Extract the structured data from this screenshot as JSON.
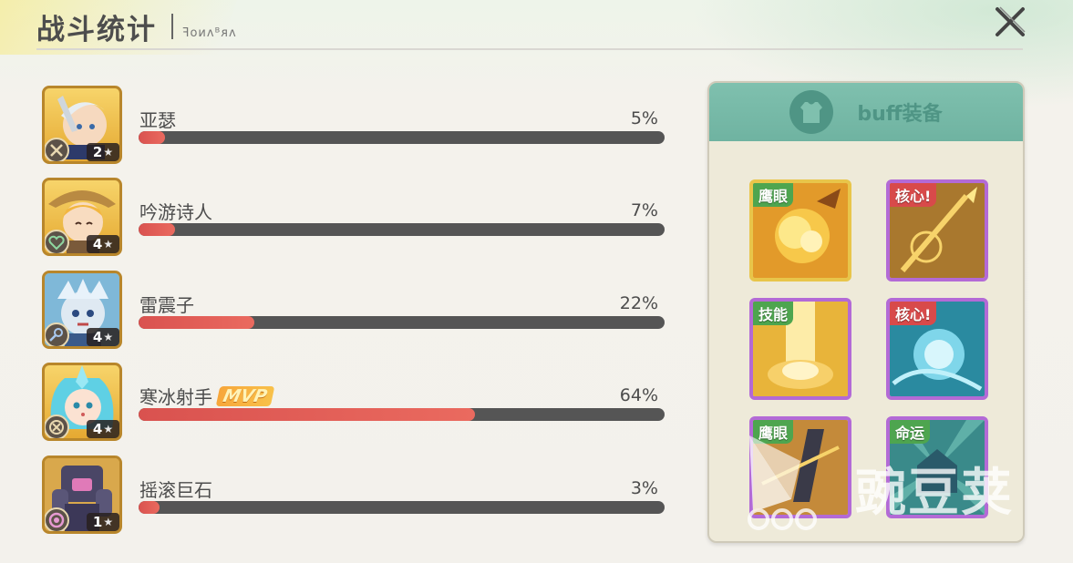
{
  "header": {
    "title": "战斗统计",
    "subtitle": "ꟻᴏᴎᴧᴮᴙᴧ"
  },
  "heroes": [
    {
      "name": "亚瑟",
      "percent": 5,
      "percent_label": "5%",
      "stars": "2",
      "mvp": ""
    },
    {
      "name": "吟游诗人",
      "percent": 7,
      "percent_label": "7%",
      "stars": "4",
      "mvp": ""
    },
    {
      "name": "雷震子",
      "percent": 22,
      "percent_label": "22%",
      "stars": "4",
      "mvp": ""
    },
    {
      "name": "寒冰射手",
      "percent": 64,
      "percent_label": "64%",
      "stars": "4",
      "mvp": "MVP"
    },
    {
      "name": "摇滚巨石",
      "percent": 3,
      "percent_label": "3%",
      "stars": "1",
      "mvp": ""
    }
  ],
  "buff_panel": {
    "title": "buff装备",
    "cards": [
      {
        "tag": "鹰眼",
        "tag_color": "#4ea54f",
        "frame": "gold",
        "icon": "explosion-icon"
      },
      {
        "tag": "核心!",
        "tag_color": "#d84a4a",
        "frame": "purple",
        "icon": "spear-icon"
      },
      {
        "tag": "技能",
        "tag_color": "#4ea54f",
        "frame": "purple",
        "icon": "light-beam-icon"
      },
      {
        "tag": "核心!",
        "tag_color": "#d84a4a",
        "frame": "purple",
        "icon": "ice-orb-icon"
      },
      {
        "tag": "鹰眼",
        "tag_color": "#4ea54f",
        "frame": "purple",
        "icon": "crossbow-icon"
      },
      {
        "tag": "命运",
        "tag_color": "#4ea54f",
        "frame": "purple",
        "icon": "fate-rays-icon"
      }
    ]
  },
  "watermark": {
    "text": "豌豆荚"
  },
  "colors": {
    "bar_fill": "#e05b55",
    "bar_track": "#555555",
    "panel_head": "#77b9a7"
  }
}
